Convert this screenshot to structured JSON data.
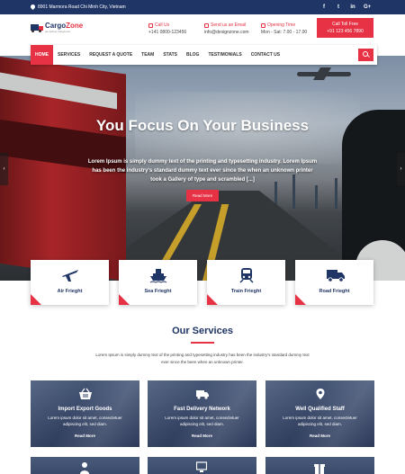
{
  "topbar": {
    "address": "8901 Marmora Road Chi Minh City, Vietnam",
    "social": [
      "f",
      "t",
      "in",
      "G+"
    ]
  },
  "header": {
    "logo_name": "Cargo",
    "logo_name_accent": "Zone",
    "logo_tagline": "we deliver happiness",
    "call_us_label": "Call Us",
    "call_us_value": "+141 0800-123456",
    "email_label": "Send us an Email",
    "email_value": "info@dexignzone.com",
    "hours_label": "Opening Time",
    "hours_value": "Mon - Sat: 7.00 - 17.00",
    "tollfree_label": "Call Toll Free",
    "tollfree_value": "+91 123 456 7890"
  },
  "nav": {
    "items": [
      "HOME",
      "SERVICES",
      "REQUEST A QUOTE",
      "TEAM",
      "STATS",
      "BLOG",
      "TESTIMONIALS",
      "CONTACT US"
    ]
  },
  "hero": {
    "title": "You Focus On Your Business",
    "text": "Lorem Ipsum is simply dummy text of the printing and typesetting industry. Lorem Ipsum has been the industry's standard dummy text ever since the when an unknown printer took a Gallery of type and scrambled [...]",
    "button": "Read More"
  },
  "features": [
    {
      "label": "Air Frieght",
      "icon": "plane-icon"
    },
    {
      "label": "Sea Frieght",
      "icon": "ship-icon"
    },
    {
      "label": "Train Frieght",
      "icon": "train-icon"
    },
    {
      "label": "Road Frieght",
      "icon": "truck-icon"
    }
  ],
  "services": {
    "title": "Our Services",
    "description": "Lorem Ipsum is simply dummy text of the printing and typesetting industry has been the industry's standard dummy text ever since the been when an unknown printer.",
    "cards": [
      {
        "title": "Import Export Goods",
        "text": "Lorem ipsum dolor sit amet, consectetuer adipiscing elit, sed diam.",
        "more": "Read More",
        "icon": "basket-icon"
      },
      {
        "title": "Fast Delivery Network",
        "text": "Lorem ipsum dolor sit amet, consectetuer adipiscing elit, sed diam.",
        "more": "Read More",
        "icon": "delivery-truck-icon"
      },
      {
        "title": "Well Qualified Staff",
        "text": "Lorem ipsum dolor sit amet, consectetuer adipiscing elit, sed diam.",
        "more": "Read More",
        "icon": "map-pin-icon"
      }
    ]
  },
  "colors": {
    "primary": "#1f3566",
    "accent": "#e63244"
  }
}
